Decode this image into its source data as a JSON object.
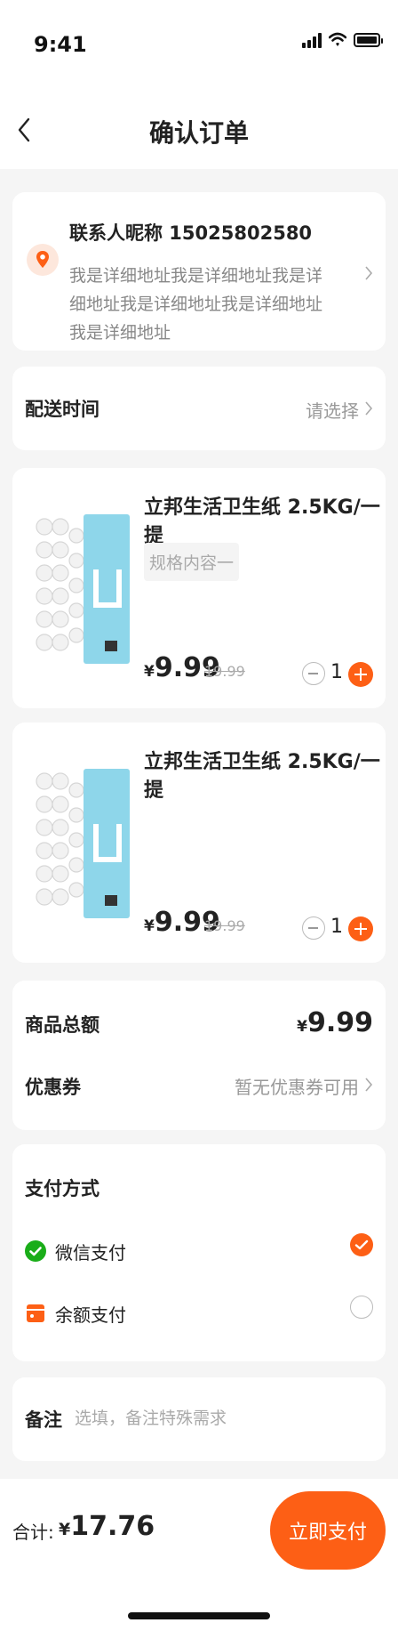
{
  "status_bar": {
    "time": "9:41"
  },
  "nav": {
    "title": "确认订单"
  },
  "address": {
    "contact": "联系人昵称 15025802580",
    "detail": "我是详细地址我是详细地址我是详细地址我是详细地址我是详细地址我是详细地址"
  },
  "delivery": {
    "label": "配送时间",
    "value": "请选择"
  },
  "products": [
    {
      "title": "立邦生活卫生纸 2.5KG/一提",
      "spec": "规格内容一",
      "currency": "¥",
      "price": "9.99",
      "original_price": "19.99",
      "quantity": "1"
    },
    {
      "title": "立邦生活卫生纸 2.5KG/一提",
      "spec": "",
      "currency": "¥",
      "price": "9.99",
      "original_price": "19.99",
      "quantity": "1"
    }
  ],
  "summary": {
    "total_label": "商品总额",
    "currency": "¥",
    "total_value": "9.99",
    "coupon_label": "优惠券",
    "coupon_value": "暂无优惠券可用"
  },
  "payment": {
    "title": "支付方式",
    "methods": [
      {
        "label": "微信支付",
        "selected": true
      },
      {
        "label": "余额支付",
        "selected": false
      }
    ]
  },
  "remark": {
    "label": "备注",
    "placeholder": "选填，备注特殊需求"
  },
  "footer": {
    "total_label": "合计:",
    "currency": "¥",
    "total_value": "17.76",
    "pay_button": "立即支付"
  },
  "colors": {
    "accent": "#fd5f15",
    "wechat": "#1aad19",
    "background": "#f5f5f5"
  }
}
